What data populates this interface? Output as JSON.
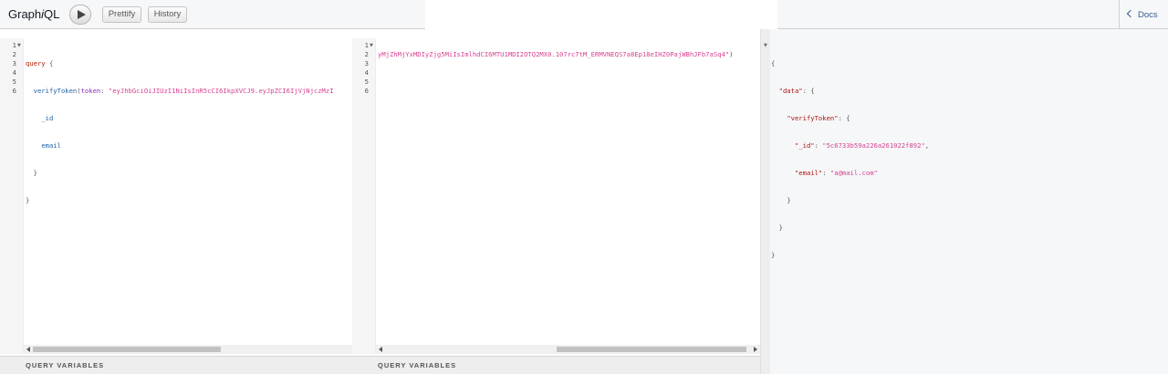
{
  "app": {
    "title_prefix": "Graph",
    "title_i": "i",
    "title_suffix": "QL"
  },
  "toolbar": {
    "prettify_label": "Prettify",
    "history_label": "History",
    "docs_label": "Docs"
  },
  "editor1": {
    "line_numbers": [
      "1",
      "2",
      "3",
      "4",
      "5",
      "6"
    ],
    "tokens": {
      "l1_kw": "query",
      "l1_brace": " {",
      "l2_field": "verifyToken",
      "l2_paren": "(",
      "l2_arg": "token",
      "l2_colon": ": ",
      "l2_str": "\"eyJhbGciOiJIUzI1NiIsInR5cCI6IkpXVCJ9.eyJpZCI6IjVjNjczMzI",
      "l3_field": "_id",
      "l4_field": "email",
      "l5_close": "}",
      "l6_close": "}"
    }
  },
  "editor2": {
    "line_numbers": [
      "1",
      "2",
      "3",
      "4",
      "5",
      "6"
    ],
    "l2_str": "yMjZhMjYxMDIyZjg5MiIsImlhdCI6MTU1MDI2OTQ2MX0.107rc7tM_ERMVNEQS7a8Ep18eIHZ0PajWBhJFb7aSq4\"",
    "l2_close": ")"
  },
  "query_variables_label": "QUERY VARIABLES",
  "result": {
    "open": "{",
    "data_key": "\"data\"",
    "verify_key": "\"verifyToken\"",
    "id_key": "\"_id\"",
    "id_value": "\"5c6733b59a226a261022f892\"",
    "email_key": "\"email\"",
    "email_value": "\"a@mail.com\"",
    "colon_brace": ": {",
    "colon": ": ",
    "comma": ",",
    "close": "}"
  },
  "icons": {
    "run": "play-icon",
    "docs": "chevron-left-icon",
    "fold": "fold-arrow-icon"
  }
}
